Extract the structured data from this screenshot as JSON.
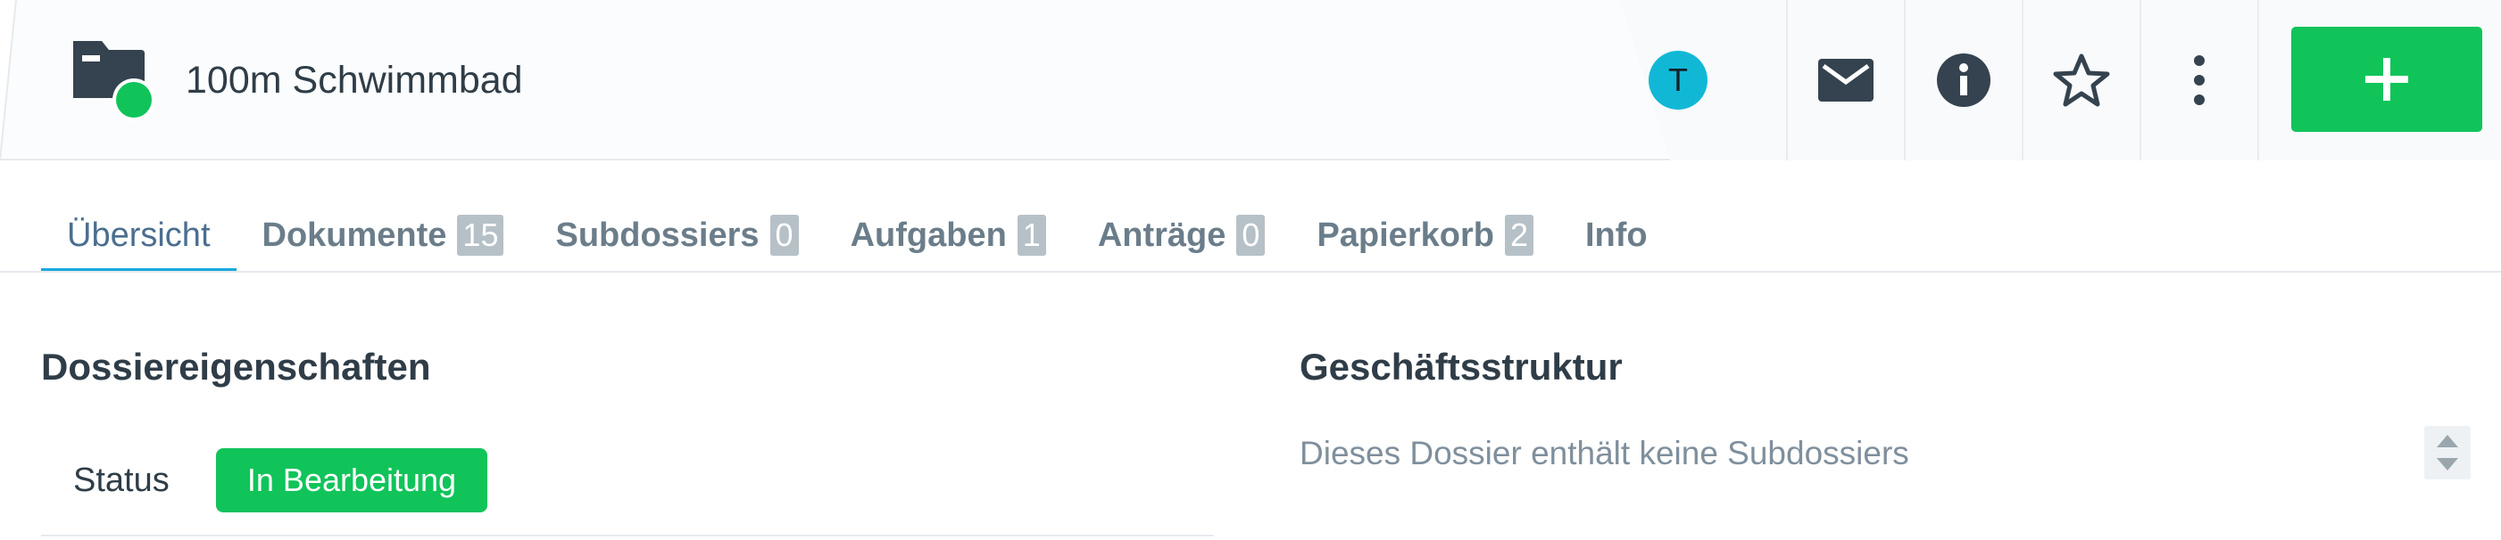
{
  "header": {
    "title": "100m Schwimmbad",
    "icon": "folder-status-icon",
    "status_dot_color": "#10c45a"
  },
  "actions": {
    "avatar_initial": "T",
    "icons": [
      "mail-icon",
      "info-icon",
      "star-icon",
      "more-vertical-icon",
      "plus-icon"
    ],
    "add_button_color": "#10c45a"
  },
  "tabs": [
    {
      "label": "Übersicht",
      "badge": null,
      "active": true
    },
    {
      "label": "Dokumente",
      "badge": "15"
    },
    {
      "label": "Subdossiers",
      "badge": "0"
    },
    {
      "label": "Aufgaben",
      "badge": "1"
    },
    {
      "label": "Anträge",
      "badge": "0"
    },
    {
      "label": "Papierkorb",
      "badge": "2"
    },
    {
      "label": "Info",
      "badge": null
    }
  ],
  "properties": {
    "title": "Dossiereigenschaften",
    "status_label": "Status",
    "status_value": "In Bearbeitung"
  },
  "structure": {
    "title": "Geschäftsstruktur",
    "empty_text": "Dieses Dossier enthält keine Subdossiers"
  },
  "colors": {
    "accent": "#16a8df",
    "success": "#10c45a",
    "badge": "#b6c0c7"
  }
}
